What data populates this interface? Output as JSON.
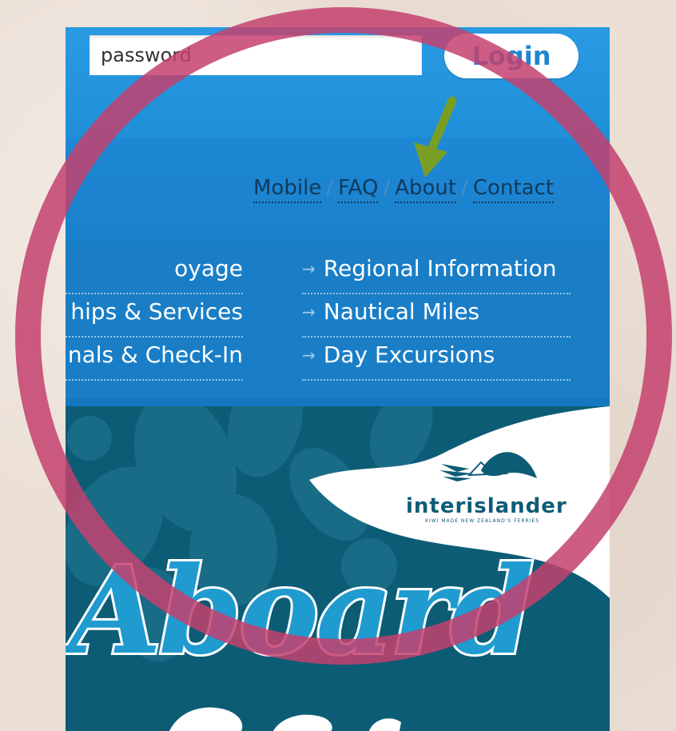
{
  "login": {
    "password_placeholder": "password",
    "button_label": "Login"
  },
  "utility_nav": {
    "items": [
      "Mobile",
      "FAQ",
      "About",
      "Contact"
    ],
    "separator": "/"
  },
  "main_menu": {
    "left_column": [
      "oyage",
      "hips & Services",
      "nals & Check-In"
    ],
    "right_column": [
      "Regional Information",
      "Nautical Miles",
      "Day Excursions"
    ],
    "arrow_glyph": "→"
  },
  "banner": {
    "brand_logo_text": "interislander",
    "brand_tagline": "KIWI MADE NEW ZEALAND'S FERRIES",
    "headline_fragment": "Aboard"
  },
  "annotations": {
    "highlight_circle_color": "#c4416f",
    "pointer_arrow_color": "#7a9e24",
    "pointer_target": "About"
  },
  "colors": {
    "header_blue": "#2a9ae2",
    "nav_blue": "#1e88d4",
    "menu_blue": "#1a7ec7",
    "banner_teal": "#0d5c76"
  }
}
